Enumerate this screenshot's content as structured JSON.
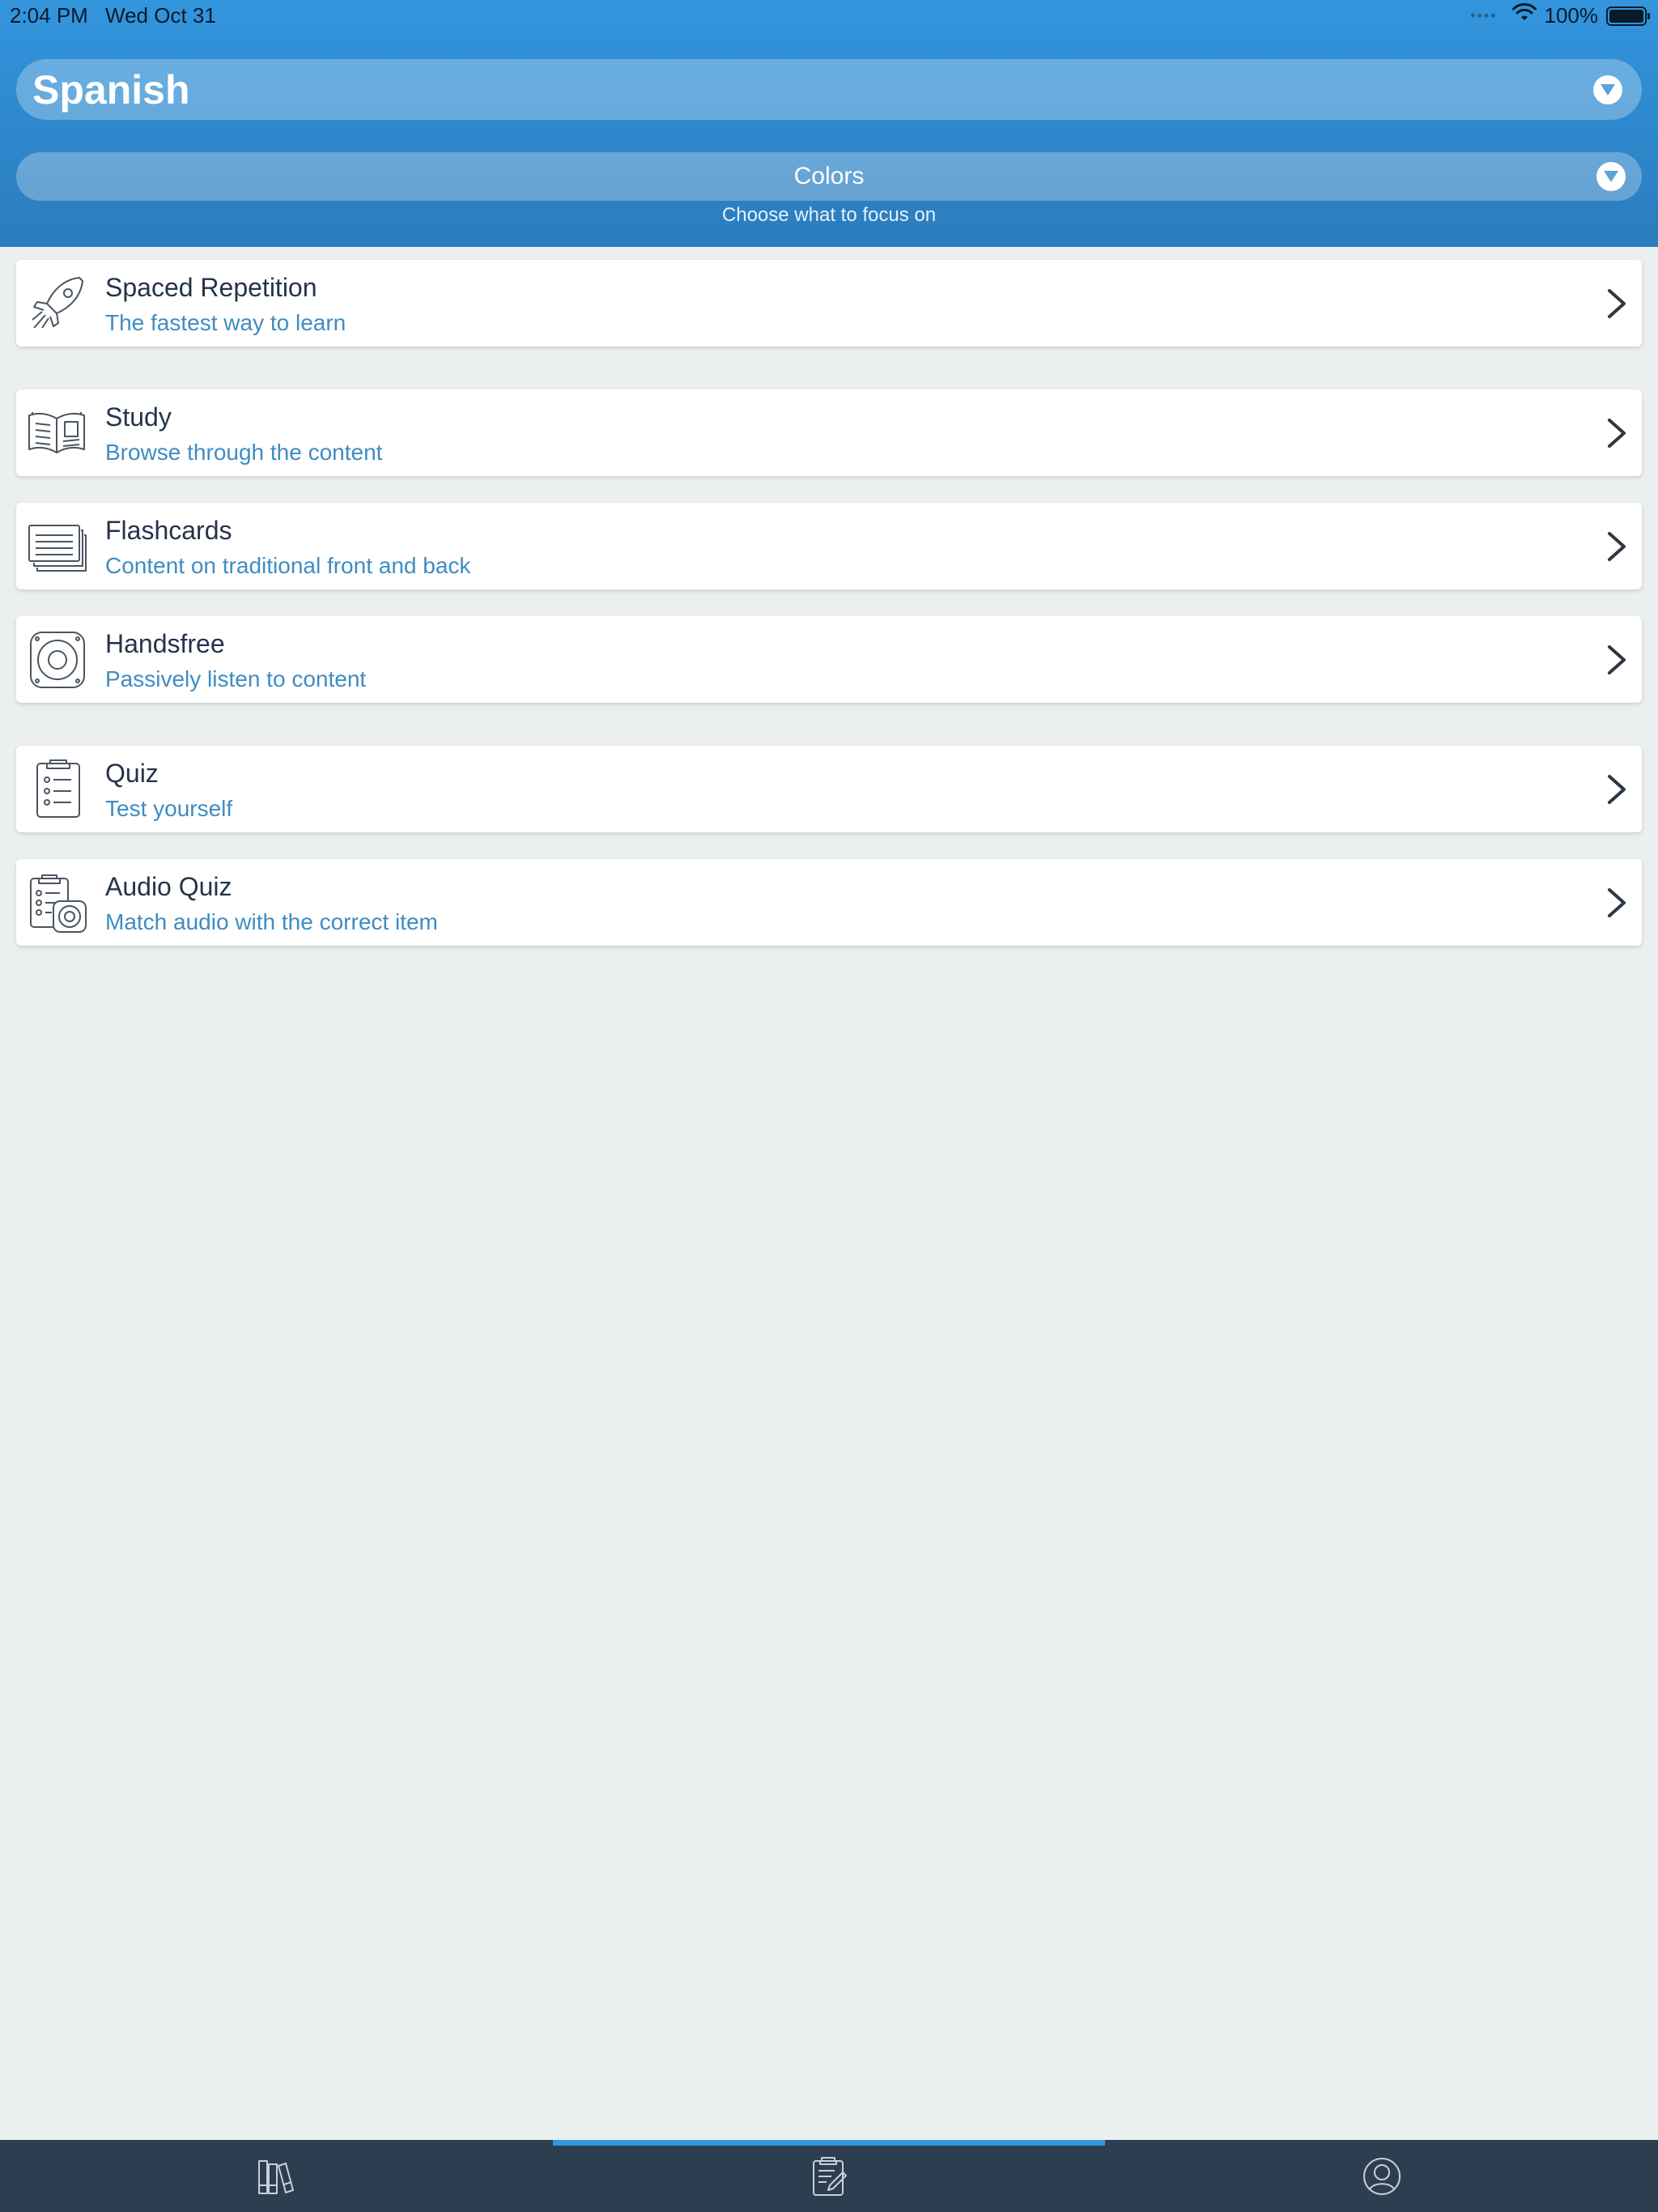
{
  "status_bar": {
    "time": "2:04 PM",
    "date": "Wed Oct 31",
    "battery": "100%",
    "battery_level": 1.0
  },
  "header": {
    "language": "Spanish",
    "topic": "Colors",
    "topic_hint": "Choose what to focus on"
  },
  "modes": [
    {
      "title": "Spaced Repetition",
      "subtitle": "The fastest way to learn",
      "icon": "rocket-icon"
    },
    {
      "title": "Study",
      "subtitle": "Browse through the content",
      "icon": "open-book-icon"
    },
    {
      "title": "Flashcards",
      "subtitle": "Content on traditional front and back",
      "icon": "flashcards-icon"
    },
    {
      "title": "Handsfree",
      "subtitle": "Passively listen to content",
      "icon": "speaker-icon"
    },
    {
      "title": "Quiz",
      "subtitle": "Test yourself",
      "icon": "clipboard-checklist-icon"
    },
    {
      "title": "Audio Quiz",
      "subtitle": "Match audio with the correct item",
      "icon": "clipboard-audio-icon"
    }
  ],
  "tabbar": {
    "tabs": [
      {
        "icon": "library-books-icon",
        "selected": false
      },
      {
        "icon": "clipboard-edit-icon",
        "selected": true
      },
      {
        "icon": "profile-icon",
        "selected": false
      }
    ]
  },
  "colors": {
    "header_blue": "#2f8bd1",
    "subtitle_blue": "#3f8cc2",
    "title_text": "#25334a",
    "tabbar_bg": "#2d3e51",
    "tab_indicator": "#3397df",
    "page_bg": "#ebeff0"
  }
}
